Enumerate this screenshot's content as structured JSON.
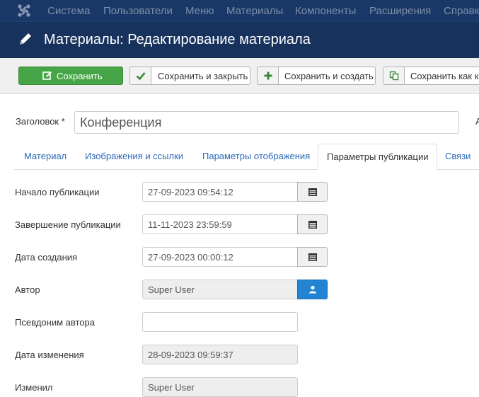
{
  "nav": {
    "items": [
      {
        "label": "Система"
      },
      {
        "label": "Пользователи"
      },
      {
        "label": "Меню"
      },
      {
        "label": "Материалы"
      },
      {
        "label": "Компоненты"
      },
      {
        "label": "Расширения"
      },
      {
        "label": "Справк"
      }
    ]
  },
  "header": {
    "title": "Материалы: Редактирование материала"
  },
  "toolbar": {
    "save_label": "Сохранить",
    "save_close_label": "Сохранить и закрыть",
    "save_new_label": "Сохранить и создать",
    "save_copy_label": "Сохранить как ко"
  },
  "form": {
    "title_label": "Заголовок *",
    "title_value": "Конференция",
    "right_cut_text": "А"
  },
  "tabs": [
    {
      "label": "Материал",
      "active": false
    },
    {
      "label": "Изображения и ссылки",
      "active": false
    },
    {
      "label": "Параметры отображения",
      "active": false
    },
    {
      "label": "Параметры публикации",
      "active": true
    },
    {
      "label": "Связи",
      "active": false
    }
  ],
  "fields": {
    "publish_up": {
      "label": "Начало публикации",
      "value": "27-09-2023 09:54:12"
    },
    "publish_down": {
      "label": "Завершение публикации",
      "value": "11-11-2023 23:59:59"
    },
    "created": {
      "label": "Дата создания",
      "value": "27-09-2023 00:00:12"
    },
    "author": {
      "label": "Автор",
      "value": "Super User"
    },
    "author_alias": {
      "label": "Псевдоним автора",
      "value": ""
    },
    "modified": {
      "label": "Дата изменения",
      "value": "28-09-2023 09:59:37"
    },
    "modified_by": {
      "label": "Изменил",
      "value": "Super User"
    }
  },
  "colors": {
    "nav_bg": "#1a3867",
    "title_bg": "#17325d",
    "save_green": "#46a546",
    "link_blue": "#2a69b8",
    "user_btn_blue": "#2384d3"
  }
}
